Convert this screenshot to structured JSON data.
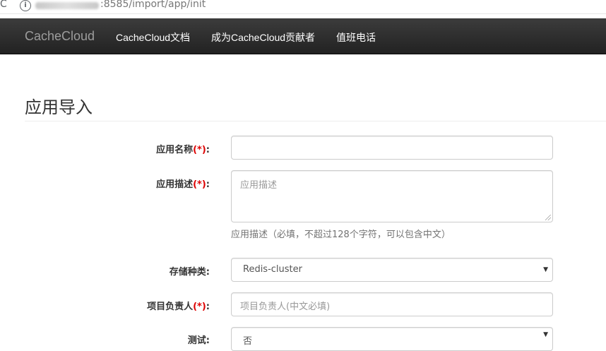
{
  "browser": {
    "url": ":8585/import/app/init"
  },
  "navbar": {
    "brand": "CacheCloud",
    "links": [
      "CacheCloud文档",
      "成为CacheCloud贡献者",
      "值班电话"
    ]
  },
  "page": {
    "title": "应用导入"
  },
  "form": {
    "app_name": {
      "label": "应用名称",
      "required": "(*)",
      "suffix": ":",
      "value": ""
    },
    "app_desc": {
      "label": "应用描述",
      "required": "(*)",
      "suffix": ":",
      "placeholder": "应用描述",
      "help": "应用描述（必填，不超过128个字符，可以包含中文）"
    },
    "storage_type": {
      "label": "存储种类",
      "suffix": ":",
      "selected": "Redis-cluster"
    },
    "owner": {
      "label": "项目负责人",
      "required": "(*)",
      "suffix": ":",
      "placeholder": "项目负责人(中文必填)"
    },
    "test": {
      "label": "测试",
      "suffix": ":",
      "selected": "否"
    }
  },
  "icons": [
    "reload-icon",
    "info-icon",
    "chevron-down-icon"
  ]
}
